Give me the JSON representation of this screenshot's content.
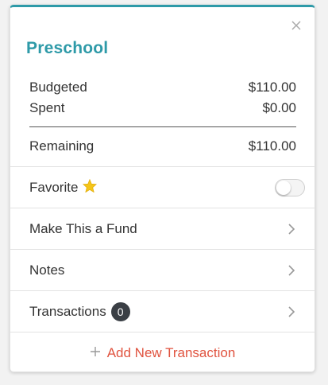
{
  "card": {
    "title": "Preschool",
    "accent_color": "#2e9aa8",
    "close_icon": "close-icon"
  },
  "summary": {
    "budgeted_label": "Budgeted",
    "budgeted_value": "$110.00",
    "spent_label": "Spent",
    "spent_value": "$0.00",
    "remaining_label": "Remaining",
    "remaining_value": "$110.00"
  },
  "items": {
    "favorite_label": "Favorite",
    "favorite_icon": "star-icon",
    "favorite_on": false,
    "fund_label": "Make This a Fund",
    "notes_label": "Notes",
    "transactions_label": "Transactions",
    "transactions_count": "0"
  },
  "actions": {
    "add_transaction_label": "Add New Transaction",
    "add_color": "#e0533f"
  }
}
